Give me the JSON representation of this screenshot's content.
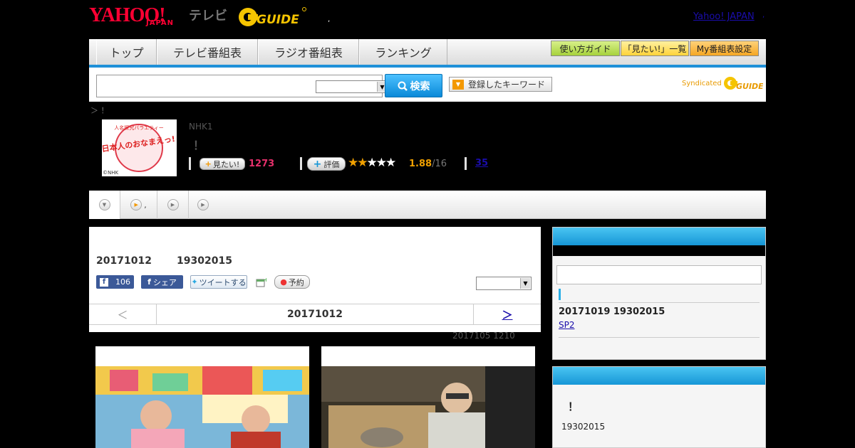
{
  "header": {
    "logo_yahoo": "YAHOO!",
    "logo_japan": "JAPAN",
    "logo_tv": "テレビ",
    "dot_left": ",",
    "yahoo_japan_link": "Yahoo! JAPAN",
    "dot_right": ","
  },
  "nav": {
    "tabs": [
      "トップ",
      "テレビ番組表",
      "ラジオ番組表",
      "ランキング"
    ],
    "buttons": [
      "使い方ガイド",
      "「見たい!」一覧",
      "My番組表設定"
    ],
    "button_colors": [
      "#a6d23c",
      "#ffd33a",
      "#f5a623"
    ]
  },
  "search": {
    "button_label": "検索",
    "keyword_button": "登録したキーワード",
    "syndicated": "Syndicated"
  },
  "breadcrumb": "＞ ！",
  "program": {
    "thumb_caption": "©NHK",
    "thumb_title": "日本人のおなまえっ!",
    "thumb_tag": "人名探究バラエティー",
    "channel": "NHK1",
    "title": "！",
    "mitai_label": "見たい!",
    "mitai_count": "1273",
    "hyouka_label": "評価",
    "rating": 1.88,
    "score": "1.88",
    "score_of": "/16",
    "reviews": "35",
    "accent_pink": "#e6306b",
    "accent_gold": "#f0a000"
  },
  "tabs_strip": {
    "second_label": ","
  },
  "main": {
    "date": "20171012",
    "time": "19302015",
    "fb_like": "106",
    "fb_share": "シェア",
    "tweet": "ツイートする",
    "yoyaku": "予約",
    "pager_prev": "＜",
    "pager_date": "20171012",
    "pager_next": "＞",
    "updated": "2017105  1210"
  },
  "sidebar": {
    "next_date": "20171019  19302015",
    "next_link": "SP2",
    "box2_title": "！",
    "box2_time": "19302015"
  }
}
